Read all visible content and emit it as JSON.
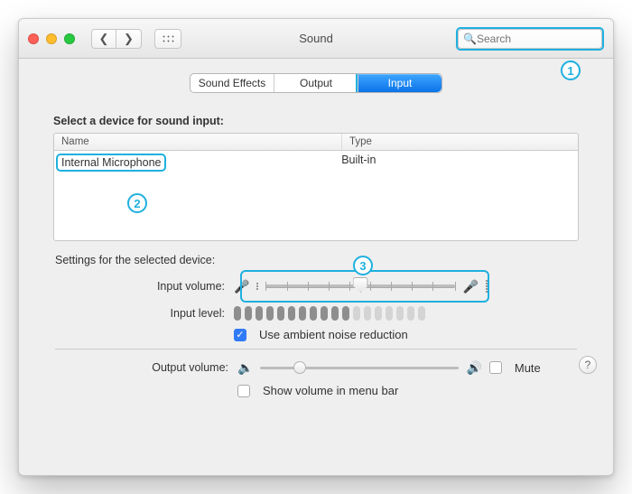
{
  "window_title": "Sound",
  "search": {
    "placeholder": "Search"
  },
  "tabs": {
    "effects": "Sound Effects",
    "output": "Output",
    "input": "Input"
  },
  "input_panel": {
    "heading": "Select a device for sound input:",
    "columns": {
      "name": "Name",
      "type": "Type"
    },
    "devices": [
      {
        "name": "Internal Microphone",
        "type": "Built-in"
      }
    ],
    "settings_label": "Settings for the selected device:",
    "input_volume_label": "Input volume:",
    "input_volume_percent": 50,
    "input_level_label": "Input level:",
    "input_level_active_bars": 11,
    "input_level_total_bars": 18,
    "ambient_label": "Use ambient noise reduction",
    "ambient_checked": true
  },
  "output": {
    "label": "Output volume:",
    "volume_percent": 20,
    "mute_label": "Mute",
    "menubar_label": "Show volume in menu bar"
  },
  "callouts": {
    "one": "1",
    "two": "2",
    "three": "3"
  }
}
